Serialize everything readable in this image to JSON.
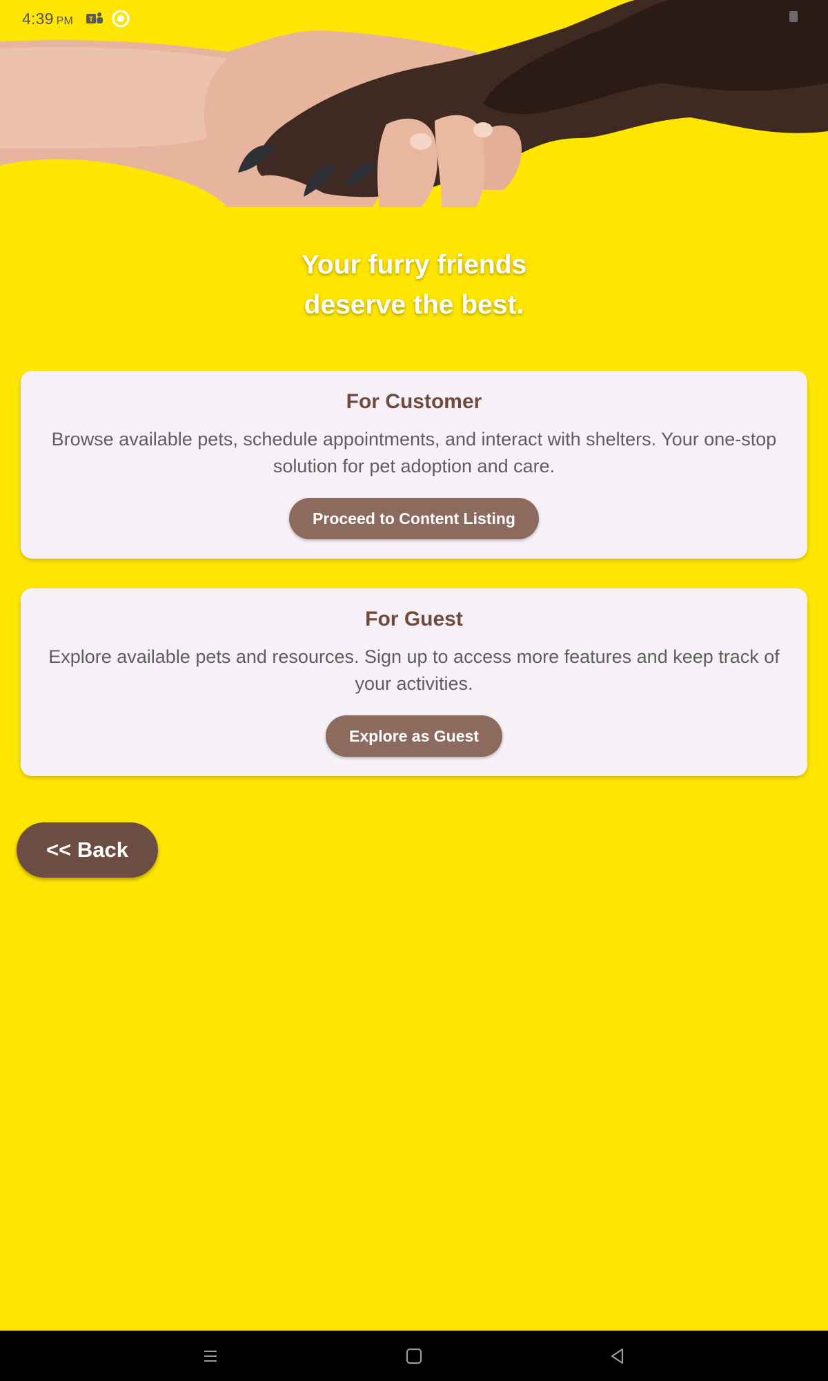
{
  "status_bar": {
    "time": "4:39",
    "ampm": "PM",
    "icons": [
      "teams-icon",
      "app-notification-icon"
    ],
    "battery_icon": "battery-icon"
  },
  "hero": {
    "image": "hand-holding-dog-paw",
    "tagline_line1": "Your furry friends",
    "tagline_line2": "deserve the best."
  },
  "customer_card": {
    "title": "For Customer",
    "description": "Browse available pets, schedule appointments, and interact with shelters. Your one-stop solution for pet adoption and care.",
    "button_label": "Proceed to Content Listing"
  },
  "guest_card": {
    "title": "For Guest",
    "description": "Explore available pets and resources. Sign up to access more features and keep track of your activities.",
    "button_label": "Explore as Guest"
  },
  "back_button": {
    "label": "<< Back"
  },
  "nav_bar": {
    "buttons": [
      "recent-apps-icon",
      "home-icon",
      "back-nav-icon"
    ]
  },
  "colors": {
    "background": "#FFE600",
    "card": "#F6F0F7",
    "card_title": "#6F4A3E",
    "card_button": "#8C6A5D",
    "back_button": "#6D4C41"
  }
}
